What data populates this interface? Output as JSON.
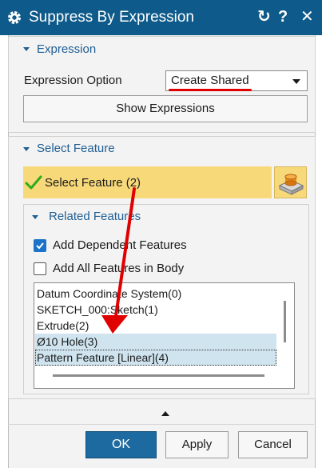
{
  "dialog": {
    "title": "Suppress By Expression",
    "title_buttons": {
      "reset": "↻",
      "help": "?",
      "close": "✕"
    }
  },
  "expression": {
    "section_title": "Expression",
    "option_label": "Expression Option",
    "option_value": "Create Shared",
    "show_button": "Show Expressions"
  },
  "select_feature": {
    "section_title": "Select Feature",
    "row_label": "Select Feature (2)"
  },
  "related_features": {
    "section_title": "Related Features",
    "add_dependent": {
      "label": "Add Dependent Features",
      "checked": true
    },
    "add_all": {
      "label": "Add All Features in Body",
      "checked": false
    },
    "items": [
      {
        "label": "Datum Coordinate System(0)",
        "highlighted": false
      },
      {
        "label": "SKETCH_000:Sketch(1)",
        "highlighted": false
      },
      {
        "label": "Extrude(2)",
        "highlighted": false
      },
      {
        "label": "Ø10 Hole(3)",
        "highlighted": true
      },
      {
        "label": "Pattern Feature [Linear](4)",
        "highlighted": true
      }
    ]
  },
  "footer": {
    "ok": "OK",
    "apply": "Apply",
    "cancel": "Cancel"
  },
  "colors": {
    "title_bar": "#0e5a8a",
    "accent": "#1f5e93",
    "selection_row": "#f8d97a",
    "highlight_row": "#cfe4ef",
    "annotation": "#e00000"
  }
}
